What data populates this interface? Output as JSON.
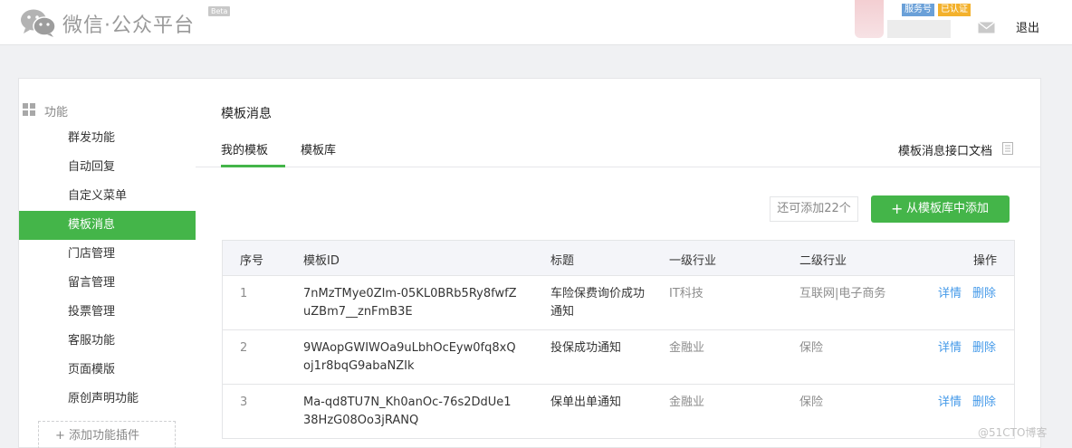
{
  "header": {
    "brand": "微信·公众平台",
    "beta": "Beta",
    "badge_service": "服务号",
    "badge_verified": "已认证",
    "logout": "退出"
  },
  "sidebar": {
    "section_title": "功能",
    "items": [
      {
        "label": "群发功能"
      },
      {
        "label": "自动回复"
      },
      {
        "label": "自定义菜单"
      },
      {
        "label": "模板消息",
        "active": true
      },
      {
        "label": "门店管理"
      },
      {
        "label": "留言管理"
      },
      {
        "label": "投票管理"
      },
      {
        "label": "客服功能"
      },
      {
        "label": "页面模版"
      },
      {
        "label": "原创声明功能"
      }
    ],
    "add_plugin": "+ 添加功能插件"
  },
  "main": {
    "title": "模板消息",
    "tabs": [
      {
        "label": "我的模板",
        "active": true
      },
      {
        "label": "模板库"
      }
    ],
    "doc_link": "模板消息接口文档",
    "remaining": "还可添加22个",
    "add_button": "从模板库中添加",
    "table": {
      "headers": [
        "序号",
        "模板ID",
        "标题",
        "一级行业",
        "二级行业",
        "操作"
      ],
      "rows": [
        {
          "no": "1",
          "id_line1": "7nMzTMye0ZIm-05KL0BRb5Ry8fwfZ",
          "id_line2": "uZBm7__znFmB3E",
          "title": "车险保费询价成功通知",
          "industry1": "IT科技",
          "industry2": "互联网|电子商务",
          "detail": "详情",
          "delete": "删除"
        },
        {
          "no": "2",
          "id_line1": "9WAopGWIWOa9uLbhOcEyw0fq8xQ",
          "id_line2": "oj1r8bqG9abaNZIk",
          "title": "投保成功通知",
          "industry1": "金融业",
          "industry2": "保险",
          "detail": "详情",
          "delete": "删除"
        },
        {
          "no": "3",
          "id_line1": "Ma-qd8TU7N_Kh0anOc-76s2DdUe1",
          "id_line2": "38HzG08Oo3jRANQ",
          "title": "保单出单通知",
          "industry1": "金融业",
          "industry2": "保险",
          "detail": "详情",
          "delete": "删除"
        }
      ]
    }
  },
  "watermark": "@51CTO博客",
  "colors": {
    "accent": "#44b549",
    "link": "#459ae9"
  }
}
